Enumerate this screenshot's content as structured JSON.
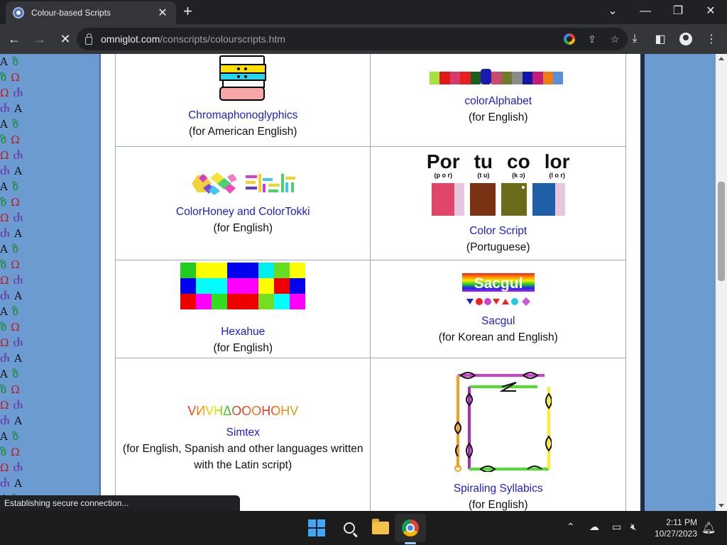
{
  "browser": {
    "tab_title": "Colour-based Scripts",
    "tab_close": "✕",
    "new_tab": "+",
    "url_host": "omniglot.com",
    "url_path": "/conscripts/colourscripts.htm",
    "status_text": "Establishing secure connection..."
  },
  "scripts": [
    {
      "name": "Chromaphonoglyphics",
      "desc": "(for American English)"
    },
    {
      "name": "colorAlphabet",
      "desc": "(for English)"
    },
    {
      "name": "ColorHoney and ColorTokki",
      "desc": "(for English)"
    },
    {
      "name": "Color Script",
      "desc": "(Portuguese)"
    },
    {
      "name": "Hexahue",
      "desc": "(for English)"
    },
    {
      "name": "Sacgul",
      "desc": "(for Korean and English)"
    },
    {
      "name": "Simtex",
      "desc": "(for English, Spanish and other languages written with the Latin script)"
    },
    {
      "name": "Spiraling Syllabics",
      "desc": "(for English)"
    }
  ],
  "color_script_sample": {
    "words": [
      "Por",
      "tu",
      "co",
      "lor"
    ],
    "ipa": [
      "(p o r)",
      "(t u)",
      "(k ɔ)",
      "(l o r)"
    ]
  },
  "sacgul_sample": "Sacgul",
  "simtex_sample": "VИVHΔOOOHOHV",
  "taskbar": {
    "time": "2:11 PM",
    "date": "10/27/2023"
  }
}
